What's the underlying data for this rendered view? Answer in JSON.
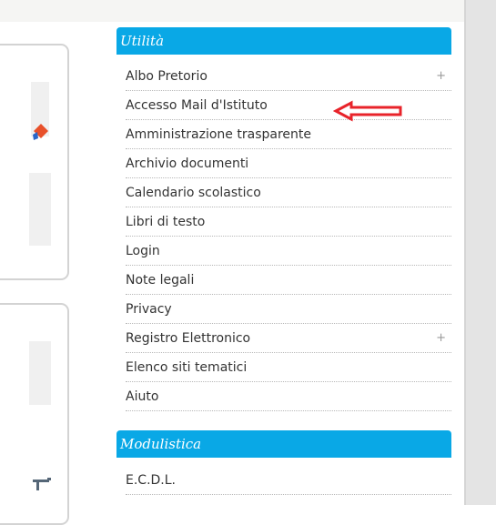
{
  "sidebar": {
    "utilita": {
      "title": "Utilità",
      "items": [
        {
          "label": "Albo Pretorio",
          "expand": "+"
        },
        {
          "label": "Accesso Mail d'Istituto"
        },
        {
          "label": "Amministrazione trasparente"
        },
        {
          "label": "Archivio documenti"
        },
        {
          "label": "Calendario scolastico"
        },
        {
          "label": "Libri di testo"
        },
        {
          "label": "Login"
        },
        {
          "label": "Note legali"
        },
        {
          "label": "Privacy"
        },
        {
          "label": "Registro Elettronico",
          "expand": "+"
        },
        {
          "label": "Elenco siti tematici"
        },
        {
          "label": "Aiuto"
        }
      ]
    },
    "modulistica": {
      "title": "Modulistica",
      "items": [
        {
          "label": "E.C.D.L."
        }
      ]
    }
  },
  "icons": {
    "annotation_arrow": "red-left-arrow-icon",
    "left_box_one": "colored-shape-icon",
    "left_box_two": "tool-icon"
  },
  "colors": {
    "widget_header": "#09a8e6",
    "annotation_arrow": "#e8232a",
    "menu_text": "#333333",
    "background": "#ffffff"
  }
}
